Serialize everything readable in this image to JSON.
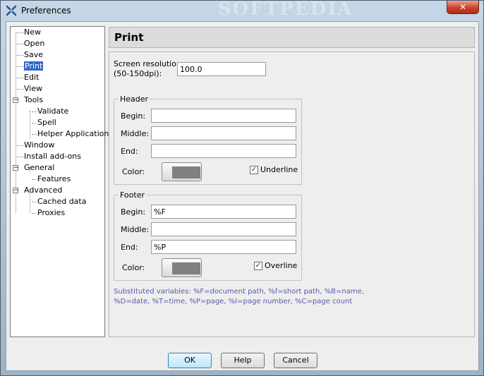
{
  "window": {
    "title": "Preferences",
    "close_glyph": "✕",
    "icon": "app-icon",
    "watermark": "SOFTPEDIA"
  },
  "tree": {
    "items": [
      {
        "label": "New",
        "level": 0,
        "selected": false
      },
      {
        "label": "Open",
        "level": 0,
        "selected": false
      },
      {
        "label": "Save",
        "level": 0,
        "selected": false
      },
      {
        "label": "Print",
        "level": 0,
        "selected": true
      },
      {
        "label": "Edit",
        "level": 0,
        "selected": false
      },
      {
        "label": "View",
        "level": 0,
        "selected": false
      },
      {
        "label": "Tools",
        "level": 0,
        "expanded": true
      },
      {
        "label": "Validate",
        "level": 1
      },
      {
        "label": "Spell",
        "level": 1
      },
      {
        "label": "Helper Applications",
        "level": 1
      },
      {
        "label": "Window",
        "level": 0
      },
      {
        "label": "Install add-ons",
        "level": 0
      },
      {
        "label": "General",
        "level": 0,
        "expanded": true
      },
      {
        "label": "Features",
        "level": 1
      },
      {
        "label": "Advanced",
        "level": 0,
        "expanded": true
      },
      {
        "label": "Cached data",
        "level": 1
      },
      {
        "label": "Proxies",
        "level": 1
      }
    ],
    "expander_glyph": "−"
  },
  "page": {
    "title": "Print",
    "resolution": {
      "label_line1": "Screen resolution",
      "label_line2": "(50-150dpi):",
      "value": "100.0"
    },
    "header": {
      "title": "Header",
      "begin_label": "Begin:",
      "begin_value": "",
      "middle_label": "Middle:",
      "middle_value": "",
      "end_label": "End:",
      "end_value": "",
      "color_label": "Color:",
      "color": "#808080",
      "checkbox_label": "Underline",
      "checked": true
    },
    "footer": {
      "title": "Footer",
      "begin_label": "Begin:",
      "begin_value": "%F",
      "middle_label": "Middle:",
      "middle_value": "",
      "end_label": "End:",
      "end_value": "%P",
      "color_label": "Color:",
      "color": "#808080",
      "checkbox_label": "Overline",
      "checked": true
    },
    "note_line1": "Substituted variables: %F=document path, %f=short path, %B=name,",
    "note_line2": "%D=date, %T=time, %P=page, %I=page number, %C=page count"
  },
  "buttons": {
    "ok": "OK",
    "help": "Help",
    "cancel": "Cancel"
  },
  "check_glyph": "✓"
}
